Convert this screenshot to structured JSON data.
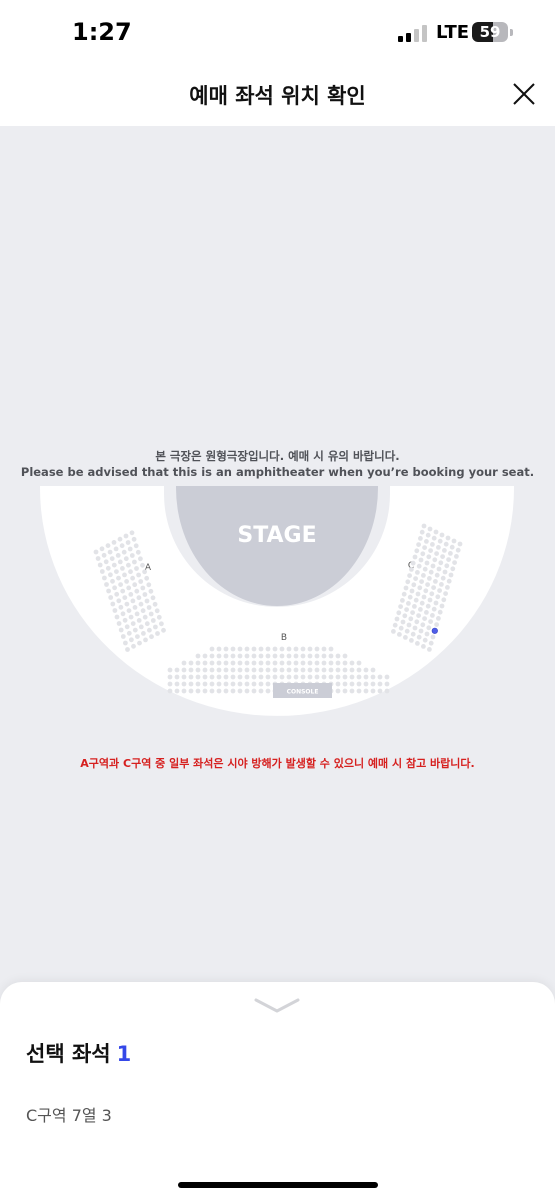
{
  "status_bar": {
    "time": "1:27",
    "network": "LTE",
    "battery": "59",
    "battery_level_percent": 59,
    "signal_bars_filled": 2
  },
  "header": {
    "title": "예매 좌석 위치 확인",
    "close_icon": "close-icon"
  },
  "seat_map": {
    "notice_ko": "본 극장은 원형극장입니다. 예매 시 유의 바랍니다.",
    "notice_en": "Please be advised that this is an amphitheater when you’re booking your seat.",
    "stage_label": "STAGE",
    "sections": [
      "A",
      "B",
      "C"
    ],
    "console_label": "CONSOLE",
    "warning": "A구역과 C구역 중 일부 좌석은 시야 방해가 발생할 수 있으니 예매 시 참고 바랍니다.",
    "selected_seat": {
      "section": "C",
      "row": 7,
      "number": 3
    },
    "colors": {
      "seat": "#e2e3e7",
      "selected_seat": "#4f5de8",
      "stage": "#cbcdd6",
      "warning": "#d6201f"
    }
  },
  "selection": {
    "label": "선택 좌석",
    "count": "1",
    "seat_text": "C구역 7열 3"
  }
}
